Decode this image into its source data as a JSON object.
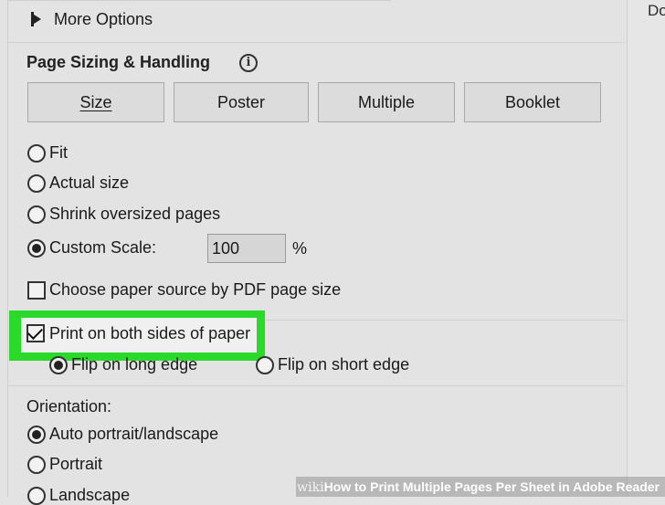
{
  "window": {
    "right_partial_text": "Do"
  },
  "more_options": {
    "label": "More Options"
  },
  "page_sizing": {
    "title": "Page Sizing & Handling",
    "info_icon": "info-icon",
    "buttons": [
      "Size",
      "Poster",
      "Multiple",
      "Booklet"
    ],
    "options": [
      {
        "label": "Fit",
        "checked": false
      },
      {
        "label": "Actual size",
        "checked": false
      },
      {
        "label": "Shrink oversized pages",
        "checked": false
      },
      {
        "label": "Custom Scale:",
        "checked": true
      }
    ],
    "custom_scale_value": "100",
    "custom_scale_unit": "%"
  },
  "paper_source": {
    "label": "Choose paper source by PDF page size",
    "checked": false
  },
  "duplex": {
    "label": "Print on both sides of paper",
    "checked": true,
    "flip_long": {
      "label": "Flip on long edge",
      "checked": true
    },
    "flip_short": {
      "label": "Flip on short edge",
      "checked": false
    }
  },
  "orientation": {
    "title": "Orientation:",
    "options": [
      {
        "label": "Auto portrait/landscape",
        "checked": true
      },
      {
        "label": "Portrait",
        "checked": false
      },
      {
        "label": "Landscape",
        "checked": false
      }
    ]
  },
  "watermark": {
    "brand": "wiki",
    "text": "How to Print Multiple Pages Per Sheet in Adobe Reader"
  },
  "colors": {
    "highlight": "#2bd92b",
    "panel_bg": "#e3e3e3"
  }
}
